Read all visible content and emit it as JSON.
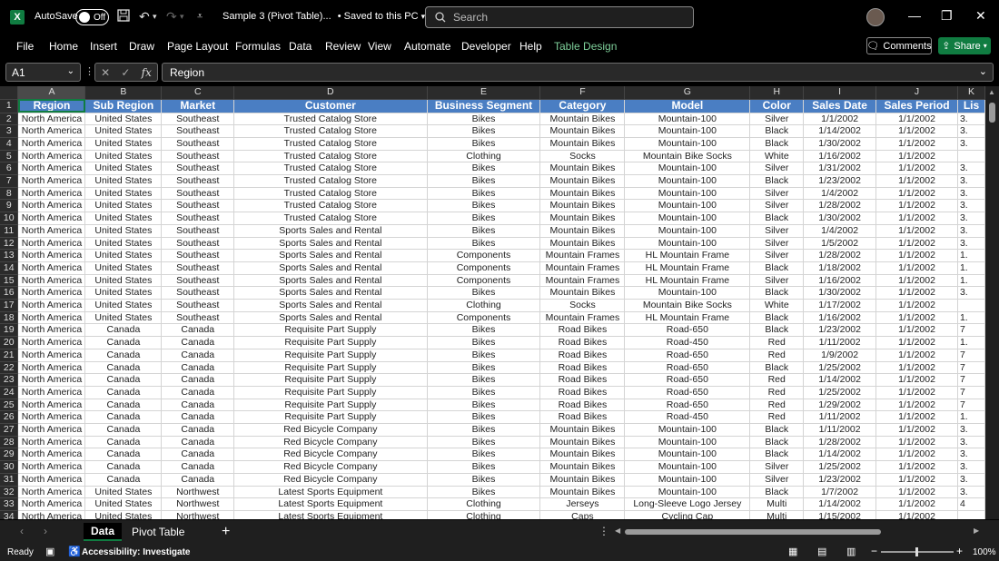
{
  "titlebar": {
    "autosave_label": "AutoSave",
    "autosave_state": "Off",
    "doc_title": "Sample 3 (Pivot Table)...",
    "save_status": "• Saved to this PC",
    "search_placeholder": "Search"
  },
  "menu": [
    "File",
    "Home",
    "Insert",
    "Draw",
    "Page Layout",
    "Formulas",
    "Data",
    "Review",
    "View",
    "Automate",
    "Developer",
    "Help",
    "Table Design"
  ],
  "buttons": {
    "comments": "Comments",
    "share": "Share"
  },
  "formula": {
    "name_box": "A1",
    "content": "Region"
  },
  "columns": [
    "A",
    "B",
    "C",
    "D",
    "E",
    "F",
    "G",
    "H",
    "I",
    "J",
    "K"
  ],
  "headers": [
    "Region",
    "Sub Region",
    "Market",
    "Customer",
    "Business Segment",
    "Category",
    "Model",
    "Color",
    "Sales Date",
    "Sales Period",
    "Lis"
  ],
  "rows": [
    [
      "North America",
      "United States",
      "Southeast",
      "Trusted Catalog Store",
      "Bikes",
      "Mountain Bikes",
      "Mountain-100",
      "Silver",
      "1/1/2002",
      "1/1/2002",
      "3."
    ],
    [
      "North America",
      "United States",
      "Southeast",
      "Trusted Catalog Store",
      "Bikes",
      "Mountain Bikes",
      "Mountain-100",
      "Black",
      "1/14/2002",
      "1/1/2002",
      "3."
    ],
    [
      "North America",
      "United States",
      "Southeast",
      "Trusted Catalog Store",
      "Bikes",
      "Mountain Bikes",
      "Mountain-100",
      "Black",
      "1/30/2002",
      "1/1/2002",
      "3."
    ],
    [
      "North America",
      "United States",
      "Southeast",
      "Trusted Catalog Store",
      "Clothing",
      "Socks",
      "Mountain Bike Socks",
      "White",
      "1/16/2002",
      "1/1/2002",
      ""
    ],
    [
      "North America",
      "United States",
      "Southeast",
      "Trusted Catalog Store",
      "Bikes",
      "Mountain Bikes",
      "Mountain-100",
      "Silver",
      "1/31/2002",
      "1/1/2002",
      "3."
    ],
    [
      "North America",
      "United States",
      "Southeast",
      "Trusted Catalog Store",
      "Bikes",
      "Mountain Bikes",
      "Mountain-100",
      "Black",
      "1/23/2002",
      "1/1/2002",
      "3."
    ],
    [
      "North America",
      "United States",
      "Southeast",
      "Trusted Catalog Store",
      "Bikes",
      "Mountain Bikes",
      "Mountain-100",
      "Silver",
      "1/4/2002",
      "1/1/2002",
      "3."
    ],
    [
      "North America",
      "United States",
      "Southeast",
      "Trusted Catalog Store",
      "Bikes",
      "Mountain Bikes",
      "Mountain-100",
      "Silver",
      "1/28/2002",
      "1/1/2002",
      "3."
    ],
    [
      "North America",
      "United States",
      "Southeast",
      "Trusted Catalog Store",
      "Bikes",
      "Mountain Bikes",
      "Mountain-100",
      "Black",
      "1/30/2002",
      "1/1/2002",
      "3."
    ],
    [
      "North America",
      "United States",
      "Southeast",
      "Sports Sales and Rental",
      "Bikes",
      "Mountain Bikes",
      "Mountain-100",
      "Silver",
      "1/4/2002",
      "1/1/2002",
      "3."
    ],
    [
      "North America",
      "United States",
      "Southeast",
      "Sports Sales and Rental",
      "Bikes",
      "Mountain Bikes",
      "Mountain-100",
      "Silver",
      "1/5/2002",
      "1/1/2002",
      "3."
    ],
    [
      "North America",
      "United States",
      "Southeast",
      "Sports Sales and Rental",
      "Components",
      "Mountain Frames",
      "HL Mountain Frame",
      "Silver",
      "1/28/2002",
      "1/1/2002",
      "1."
    ],
    [
      "North America",
      "United States",
      "Southeast",
      "Sports Sales and Rental",
      "Components",
      "Mountain Frames",
      "HL Mountain Frame",
      "Black",
      "1/18/2002",
      "1/1/2002",
      "1."
    ],
    [
      "North America",
      "United States",
      "Southeast",
      "Sports Sales and Rental",
      "Components",
      "Mountain Frames",
      "HL Mountain Frame",
      "Silver",
      "1/16/2002",
      "1/1/2002",
      "1."
    ],
    [
      "North America",
      "United States",
      "Southeast",
      "Sports Sales and Rental",
      "Bikes",
      "Mountain Bikes",
      "Mountain-100",
      "Black",
      "1/30/2002",
      "1/1/2002",
      "3."
    ],
    [
      "North America",
      "United States",
      "Southeast",
      "Sports Sales and Rental",
      "Clothing",
      "Socks",
      "Mountain Bike Socks",
      "White",
      "1/17/2002",
      "1/1/2002",
      ""
    ],
    [
      "North America",
      "United States",
      "Southeast",
      "Sports Sales and Rental",
      "Components",
      "Mountain Frames",
      "HL Mountain Frame",
      "Black",
      "1/16/2002",
      "1/1/2002",
      "1."
    ],
    [
      "North America",
      "Canada",
      "Canada",
      "Requisite Part Supply",
      "Bikes",
      "Road Bikes",
      "Road-650",
      "Black",
      "1/23/2002",
      "1/1/2002",
      "7"
    ],
    [
      "North America",
      "Canada",
      "Canada",
      "Requisite Part Supply",
      "Bikes",
      "Road Bikes",
      "Road-450",
      "Red",
      "1/11/2002",
      "1/1/2002",
      "1."
    ],
    [
      "North America",
      "Canada",
      "Canada",
      "Requisite Part Supply",
      "Bikes",
      "Road Bikes",
      "Road-650",
      "Red",
      "1/9/2002",
      "1/1/2002",
      "7"
    ],
    [
      "North America",
      "Canada",
      "Canada",
      "Requisite Part Supply",
      "Bikes",
      "Road Bikes",
      "Road-650",
      "Black",
      "1/25/2002",
      "1/1/2002",
      "7"
    ],
    [
      "North America",
      "Canada",
      "Canada",
      "Requisite Part Supply",
      "Bikes",
      "Road Bikes",
      "Road-650",
      "Red",
      "1/14/2002",
      "1/1/2002",
      "7"
    ],
    [
      "North America",
      "Canada",
      "Canada",
      "Requisite Part Supply",
      "Bikes",
      "Road Bikes",
      "Road-650",
      "Red",
      "1/25/2002",
      "1/1/2002",
      "7"
    ],
    [
      "North America",
      "Canada",
      "Canada",
      "Requisite Part Supply",
      "Bikes",
      "Road Bikes",
      "Road-650",
      "Red",
      "1/29/2002",
      "1/1/2002",
      "7"
    ],
    [
      "North America",
      "Canada",
      "Canada",
      "Requisite Part Supply",
      "Bikes",
      "Road Bikes",
      "Road-450",
      "Red",
      "1/11/2002",
      "1/1/2002",
      "1."
    ],
    [
      "North America",
      "Canada",
      "Canada",
      "Red Bicycle Company",
      "Bikes",
      "Mountain Bikes",
      "Mountain-100",
      "Black",
      "1/11/2002",
      "1/1/2002",
      "3."
    ],
    [
      "North America",
      "Canada",
      "Canada",
      "Red Bicycle Company",
      "Bikes",
      "Mountain Bikes",
      "Mountain-100",
      "Black",
      "1/28/2002",
      "1/1/2002",
      "3."
    ],
    [
      "North America",
      "Canada",
      "Canada",
      "Red Bicycle Company",
      "Bikes",
      "Mountain Bikes",
      "Mountain-100",
      "Black",
      "1/14/2002",
      "1/1/2002",
      "3."
    ],
    [
      "North America",
      "Canada",
      "Canada",
      "Red Bicycle Company",
      "Bikes",
      "Mountain Bikes",
      "Mountain-100",
      "Silver",
      "1/25/2002",
      "1/1/2002",
      "3."
    ],
    [
      "North America",
      "Canada",
      "Canada",
      "Red Bicycle Company",
      "Bikes",
      "Mountain Bikes",
      "Mountain-100",
      "Silver",
      "1/23/2002",
      "1/1/2002",
      "3."
    ],
    [
      "North America",
      "United States",
      "Northwest",
      "Latest Sports Equipment",
      "Bikes",
      "Mountain Bikes",
      "Mountain-100",
      "Black",
      "1/7/2002",
      "1/1/2002",
      "3."
    ],
    [
      "North America",
      "United States",
      "Northwest",
      "Latest Sports Equipment",
      "Clothing",
      "Jerseys",
      "Long-Sleeve Logo Jersey",
      "Multi",
      "1/14/2002",
      "1/1/2002",
      "4"
    ],
    [
      "North America",
      "United States",
      "Northwest",
      "Latest Sports Equipment",
      "Clothing",
      "Caps",
      "Cycling Cap",
      "Multi",
      "1/15/2002",
      "1/1/2002",
      ""
    ]
  ],
  "tabs": {
    "data": "Data",
    "pivot": "Pivot Table",
    "add": "+"
  },
  "status": {
    "ready": "Ready",
    "accessibility": "Accessibility: Investigate",
    "zoom": "100%"
  },
  "colors": {
    "excel_green": "#107c41",
    "header_blue": "#4a7ec3"
  }
}
